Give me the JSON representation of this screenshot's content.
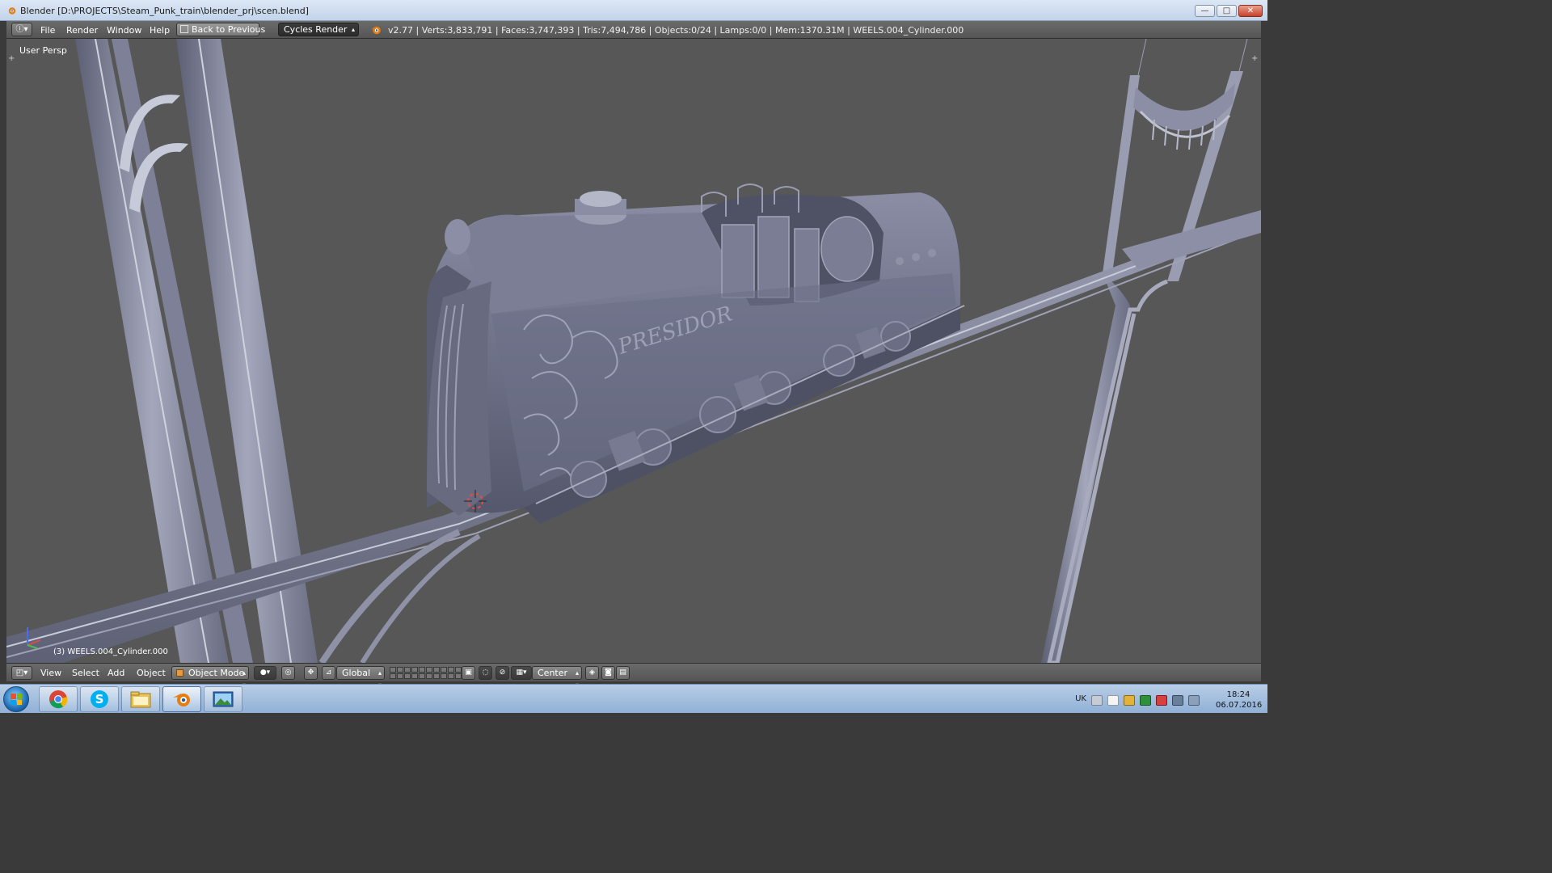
{
  "window": {
    "title": "Blender [D:\\PROJECTS\\Steam_Punk_train\\blender_prj\\scen.blend]",
    "controls": {
      "minimize": "—",
      "maximize": "□",
      "close": "✕"
    }
  },
  "info_header": {
    "editor_icon": "info-icon",
    "menu": [
      "File",
      "Render",
      "Window",
      "Help"
    ],
    "back_button": "Back to Previous",
    "render_engine": "Cycles Render",
    "stats": "v2.77 | Verts:3,833,791 | Faces:3,747,393 | Tris:7,494,786 | Objects:0/24 | Lamps:0/0 | Mem:1370.31M | WEELS.004_Cylinder.000"
  },
  "viewport": {
    "view_label": "User Persp",
    "object_label": "(3) WEELS.004_Cylinder.000",
    "engine_text": "PRESIDOR",
    "background": "#575757",
    "model_color": "#6f728a"
  },
  "view_header": {
    "menu": [
      "View",
      "Select",
      "Add",
      "Object"
    ],
    "mode": "Object Mode",
    "orientation": "Global",
    "pivot": "Center"
  },
  "taskbar": {
    "apps": [
      "chrome-icon",
      "skype-icon",
      "explorer-icon",
      "blender-icon",
      "image-viewer-icon"
    ],
    "language": "UK",
    "time": "18:24",
    "date": "06.07.2016"
  }
}
